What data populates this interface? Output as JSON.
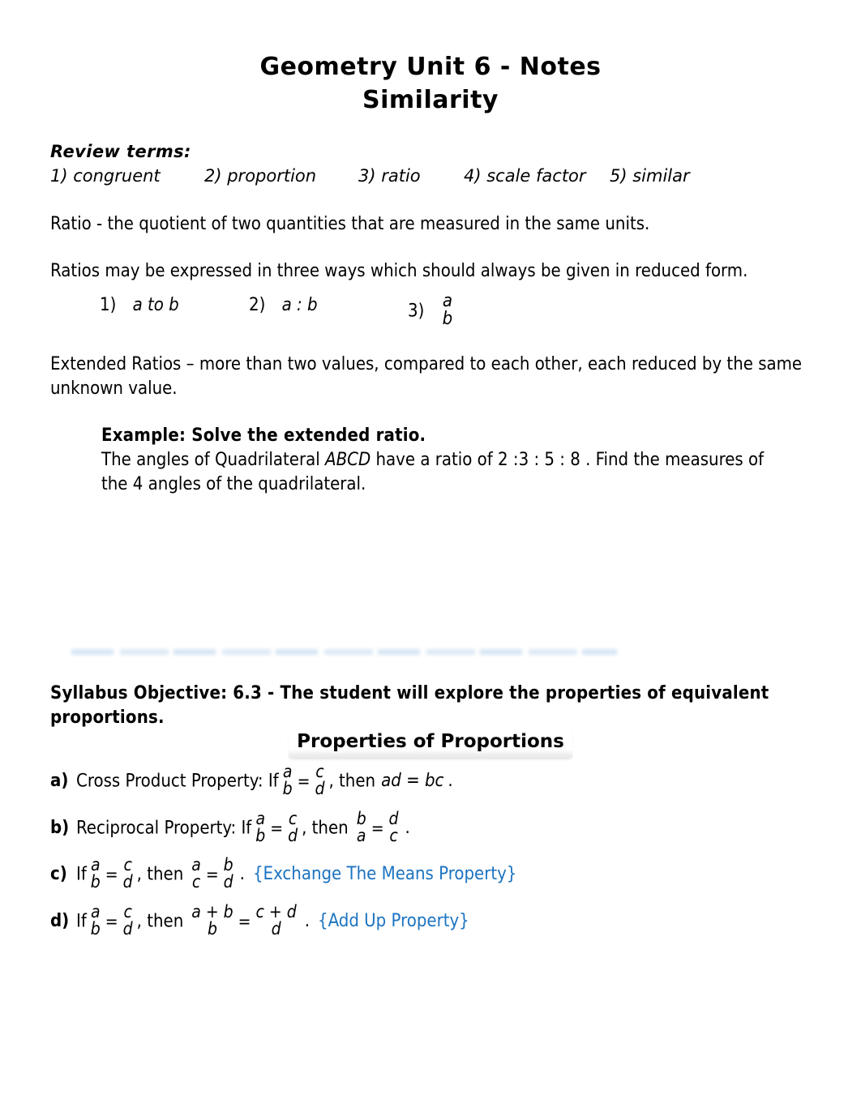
{
  "document": {
    "title_line_1": "Geometry Unit 6 - Notes",
    "title_line_2": "Similarity"
  },
  "review": {
    "heading": "Review terms:",
    "terms": [
      "1) congruent",
      "2) proportion",
      "3) ratio",
      "4) scale factor",
      "5) similar"
    ]
  },
  "ratio_definition": "Ratio  -  the quotient of two quantities that are measured in the same units.",
  "ratio_ways_intro": "Ratios may be expressed in three ways which should always be given in reduced form.",
  "ratio_ways": {
    "item1_marker": "1)",
    "item1_text": "a to b",
    "item2_marker": "2)",
    "item2_text": "a : b",
    "item3_marker": "3)",
    "item3_numerator": "a",
    "item3_denominator": "b"
  },
  "extended_ratios": {
    "line1": "Extended Ratios – more than two values, compared to each other, each reduced by the same",
    "line2": "unknown value."
  },
  "example": {
    "heading": "Example:   Solve the extended ratio.",
    "line1_part1": "The angles of Quadrilateral ",
    "line1_italic": "ABCD",
    "line1_part2": "  have a ratio of 2 :3 : 5 : 8 . Find the measures of",
    "line2": "the 4 angles of the quadrilateral."
  },
  "syllabus": {
    "line1": "Syllabus Objective: 6.3 - The student will explore the properties of equivalent",
    "line2": "proportions."
  },
  "properties": {
    "banner": "Properties of Proportions",
    "item_a": {
      "marker": "a)",
      "label": "Cross Product Property: If",
      "frac1_num": "a",
      "frac1_den": "b",
      "equals": "=",
      "frac2_num": "c",
      "frac2_den": "d",
      "conclusion_lead": ", then",
      "conclusion_expr": "ad = bc",
      "period": "."
    },
    "item_b": {
      "marker": "b)",
      "label": "Reciprocal Property: If",
      "frac1_num": "a",
      "frac1_den": "b",
      "equals": "=",
      "frac2_num": "c",
      "frac2_den": "d",
      "conclusion_lead": ", then",
      "frac3_num": "b",
      "frac3_den": "a",
      "equals2": "=",
      "frac4_num": "d",
      "frac4_den": "c",
      "period": "."
    },
    "item_c": {
      "marker": "c)",
      "label": "If",
      "frac1_num": "a",
      "frac1_den": "b",
      "equals": "=",
      "frac2_num": "c",
      "frac2_den": "d",
      "conclusion_lead": ", then",
      "frac3_num": "a",
      "frac3_den": "c",
      "equals2": "=",
      "frac4_num": "b",
      "frac4_den": "d",
      "period": ".",
      "note": "{Exchange The Means Property}"
    },
    "item_d": {
      "marker": "d)",
      "label": "If",
      "frac1_num": "a",
      "frac1_den": "b",
      "equals": "=",
      "frac2_num": "c",
      "frac2_den": "d",
      "conclusion_lead": ", then",
      "frac3_num": "a + b",
      "frac3_den": "b",
      "equals2": "=",
      "frac4_num": "c + d",
      "frac4_den": "d",
      "period": ".",
      "note": "{Add Up Property}"
    }
  },
  "colors": {
    "note_blue": "#1b73c1",
    "faded_rule": "#cfe0f2",
    "text": "#000000",
    "page_background": "#ffffff"
  }
}
